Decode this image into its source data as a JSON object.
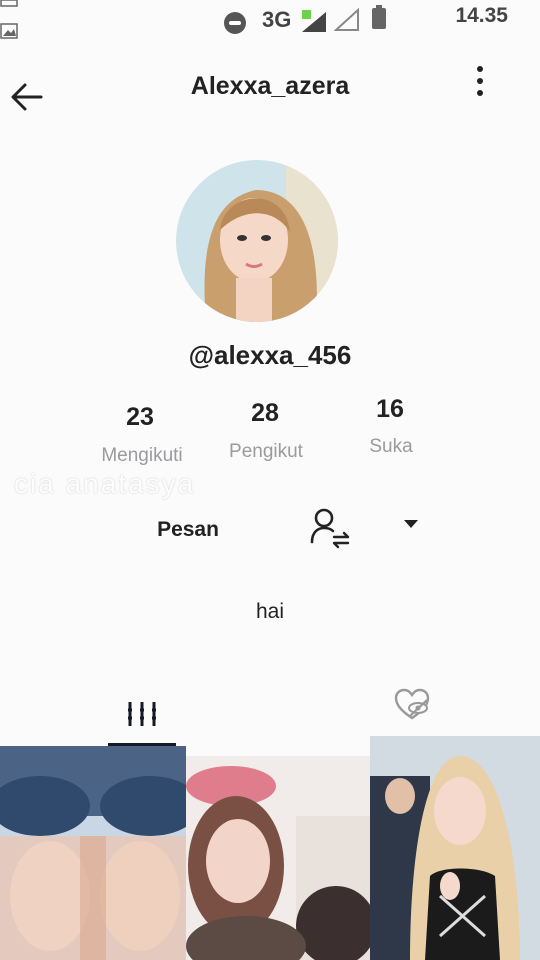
{
  "status_bar": {
    "time": "14.35",
    "network": "3G"
  },
  "header": {
    "title": "Alexxa_azera"
  },
  "profile": {
    "handle": "@alexxa_456",
    "bio": "hai",
    "stats": [
      {
        "value": "23",
        "label": "Mengikuti"
      },
      {
        "value": "28",
        "label": "Pengikut"
      },
      {
        "value": "16",
        "label": "Suka"
      }
    ]
  },
  "watermark": "cia anatasya",
  "actions": {
    "message_label": "Pesan"
  },
  "icons": {
    "back": "arrow-left-icon",
    "more": "more-vertical-icon",
    "follow": "user-swap-icon",
    "dropdown": "triangle-down-icon",
    "videos_tab": "grid-bars-icon",
    "liked_tab": "heart-eye-slash-icon"
  },
  "colors": {
    "text_primary": "#161823",
    "text_secondary": "#9a9a9f",
    "background": "#fbfbfb"
  }
}
